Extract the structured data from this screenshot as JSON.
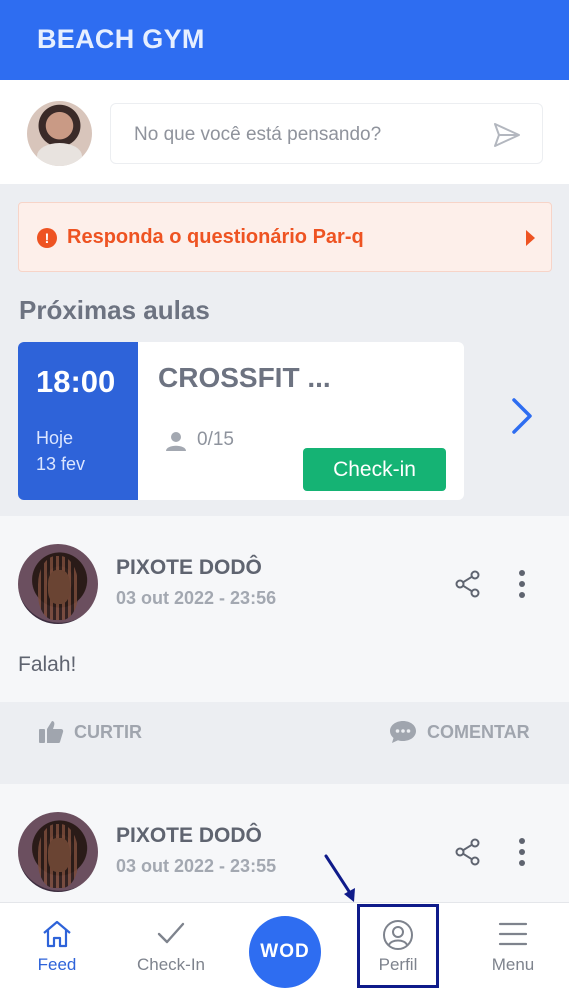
{
  "app": {
    "title": "BEACH GYM",
    "brand_color": "#2e6df1"
  },
  "compose": {
    "placeholder": "No que você está pensando?",
    "send_icon": "send-icon"
  },
  "alert": {
    "text": "Responda o questionário Par-q",
    "icon": "exclamation-circle-icon",
    "color": "#ee5322"
  },
  "upcoming": {
    "title": "Próximas aulas",
    "classes": [
      {
        "time": "18:00",
        "day": "Hoje",
        "date": "13 fev",
        "name": "CROSSFIT ...",
        "slots": "0/15",
        "checkin_label": "Check-in"
      }
    ]
  },
  "posts": [
    {
      "author": "PIXOTE DODÔ",
      "timestamp": "03 out 2022 - 23:56",
      "body": "Falah!",
      "like_label": "CURTIR",
      "comment_label": "COMENTAR"
    },
    {
      "author": "PIXOTE DODÔ",
      "timestamp": "03 out 2022 - 23:55"
    }
  ],
  "bottom_nav": {
    "feed": "Feed",
    "checkin": "Check-In",
    "wod": "WOD",
    "profile": "Perfil",
    "menu": "Menu"
  }
}
